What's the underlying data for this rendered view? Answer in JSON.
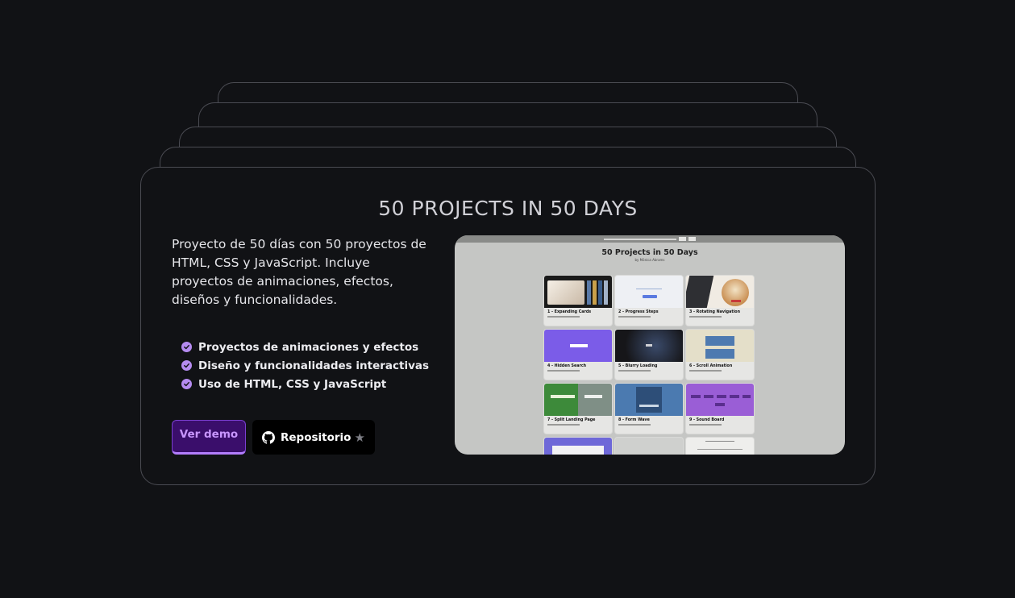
{
  "project": {
    "title": "50 PROJECTS IN 50 DAYS",
    "description": "Proyecto de 50 días con 50 proyectos de HTML, CSS y JavaScript. Incluye proyectos de animaciones, efectos, diseños y funcionalidades.",
    "features": [
      "Proyectos de animaciones y efectos",
      "Diseño y funcionalidades interactivas",
      "Uso de HTML, CSS y JavaScript"
    ],
    "demo_label": "Ver demo",
    "repo_label": "Repositorio",
    "repo_icon": "github-icon",
    "star_icon": "star-icon"
  },
  "preview": {
    "title": "50 Projects in 50 Days",
    "subtitle": "by Mónica Abrams",
    "tiles": [
      {
        "name": "1 - Expanding Cards",
        "theme": "photo"
      },
      {
        "name": "2 - Progress Steps",
        "theme": "light"
      },
      {
        "name": "3 - Rotating Navigation",
        "theme": "dog"
      },
      {
        "name": "4 - Hidden Search",
        "theme": "purple"
      },
      {
        "name": "5 - Blurry Loading",
        "theme": "dark"
      },
      {
        "name": "6 - Scroll Animation",
        "theme": "beige"
      },
      {
        "name": "7 - Split Landing Page",
        "theme": "green"
      },
      {
        "name": "8 - Form Wave",
        "theme": "steel"
      },
      {
        "name": "9 - Sound Board",
        "theme": "violet"
      }
    ]
  },
  "colors": {
    "background": "#111215",
    "accent": "#b58bf0",
    "demo_button": "#3a0e6b"
  }
}
